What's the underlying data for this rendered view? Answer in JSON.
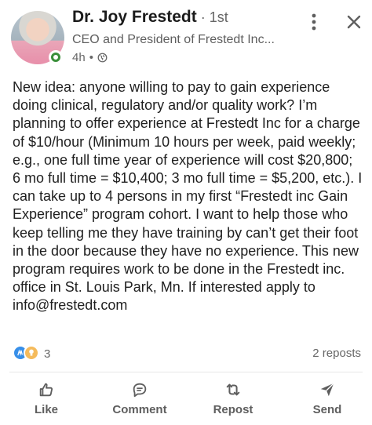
{
  "author": {
    "name": "Dr. Joy Frestedt",
    "degree": "1st",
    "headline": "CEO and President of Frestedt Inc...",
    "time": "4h",
    "visibility_icon": "globe-icon"
  },
  "post": {
    "text": "New idea: anyone willing to pay to gain experience doing clinical, regulatory and/or quality work? I’m planning to offer experience at Frestedt Inc for a charge of $10/hour (Minimum 10 hours per week, paid weekly; e.g., one full time year of experience will cost $20,800; 6 mo full time = $10,400; 3 mo full time = $5,200, etc.). I can take up to 4 persons in my first “Frestedt inc Gain Experience” program cohort. I want to help those who keep telling me they have training by can’t get their foot in the door because they have no experience. This new program requires work to be done in the Frestedt inc. office in St. Louis Park, Mn. If interested apply to info@frestedt.com"
  },
  "social": {
    "reaction_count": "3",
    "reaction_icons": [
      "clap-icon",
      "lightbulb-icon"
    ],
    "reposts": "2 reposts"
  },
  "actions": [
    {
      "label": "Like",
      "icon": "thumbs-up-icon"
    },
    {
      "label": "Comment",
      "icon": "comment-icon"
    },
    {
      "label": "Repost",
      "icon": "repost-icon"
    },
    {
      "label": "Send",
      "icon": "send-icon"
    }
  ],
  "colors": {
    "presence_green": "#3a8f3a",
    "clap_blue": "#378fe9",
    "bulb_yellow": "#f5bb5c"
  }
}
